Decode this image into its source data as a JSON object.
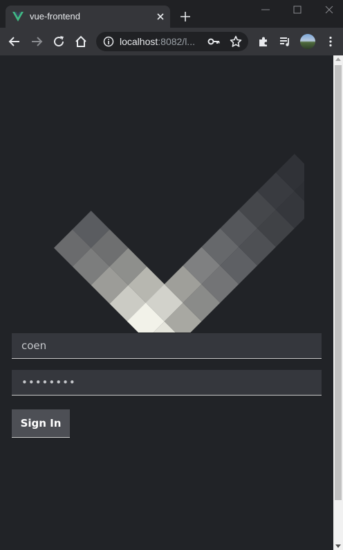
{
  "browser": {
    "tab_title": "vue-frontend",
    "url_host": "localhost",
    "url_rest": ":8082/l...",
    "icons": {
      "favicon": "vue-logo-icon",
      "tab_close": "close-icon",
      "new_tab": "plus-icon",
      "back": "arrow-left-icon",
      "forward": "arrow-right-icon",
      "reload": "reload-icon",
      "home": "home-icon",
      "site_info": "info-icon",
      "password_key": "key-icon",
      "bookmark": "star-icon",
      "extensions": "puzzle-icon",
      "media": "playlist-icon",
      "menu": "kebab-menu-icon"
    }
  },
  "login": {
    "username_value": "coen",
    "password_value": "••••••••",
    "signin_label": "Sign In"
  },
  "colors": {
    "page_background": "#212327",
    "field_background": "#35373d",
    "button_background": "#4d4f55"
  }
}
